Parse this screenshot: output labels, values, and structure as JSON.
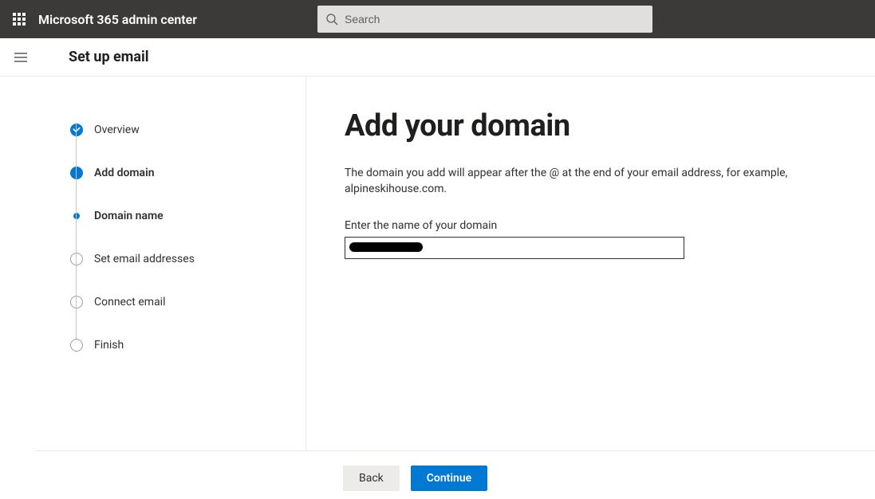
{
  "topbar": {
    "brand": "Microsoft 365 admin center",
    "search_placeholder": "Search"
  },
  "page": {
    "title": "Set up email"
  },
  "steps": {
    "overview": "Overview",
    "add_domain": "Add domain",
    "domain_name": "Domain name",
    "set_email": "Set email addresses",
    "connect_email": "Connect email",
    "finish": "Finish"
  },
  "main": {
    "heading": "Add your domain",
    "description": "The domain you add will appear after the @ at the end of your email address, for example, alpineskihouse.com.",
    "field_label": "Enter the name of your domain",
    "domain_value": ""
  },
  "footer": {
    "back": "Back",
    "continue": "Continue"
  },
  "colors": {
    "primary": "#0078d4",
    "topbar": "#3b3a39"
  }
}
